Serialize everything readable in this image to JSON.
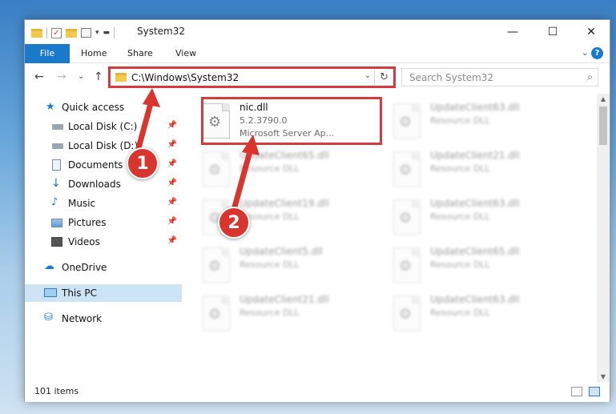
{
  "window": {
    "title": "System32",
    "controls": {
      "minimize": "—",
      "maximize": "☐",
      "close": "✕"
    }
  },
  "ribbon": {
    "tabs": [
      {
        "label": "File"
      },
      {
        "label": "Home"
      },
      {
        "label": "Share"
      },
      {
        "label": "View"
      }
    ],
    "help": "?"
  },
  "nav": {
    "address": "C:\\Windows\\System32",
    "search_placeholder": "Search System32"
  },
  "sidebar": {
    "items": [
      {
        "label": "Quick access",
        "icon": "star-icon"
      },
      {
        "label": "Local Disk (C:)",
        "icon": "drive-icon",
        "pinned": true
      },
      {
        "label": "Local Disk (D:)",
        "icon": "drive-icon",
        "pinned": true
      },
      {
        "label": "Documents",
        "icon": "documents-icon",
        "pinned": true
      },
      {
        "label": "Downloads",
        "icon": "download-icon",
        "pinned": true
      },
      {
        "label": "Music",
        "icon": "music-icon",
        "pinned": true
      },
      {
        "label": "Pictures",
        "icon": "pictures-icon",
        "pinned": true
      },
      {
        "label": "Videos",
        "icon": "videos-icon",
        "pinned": true
      },
      {
        "label": "OneDrive",
        "icon": "cloud-icon"
      },
      {
        "label": "This PC",
        "icon": "monitor-icon",
        "selected": true
      },
      {
        "label": "Network",
        "icon": "network-icon"
      }
    ]
  },
  "files": {
    "highlighted": {
      "name": "nic.dll",
      "version": "5.2.3790.0",
      "description": "Microsoft Server Ap..."
    },
    "left_column": [
      {
        "name": "UpdateClient65.dll",
        "type": "Resource DLL"
      },
      {
        "name": "UpdateClient19.dll",
        "type": "Resource DLL"
      },
      {
        "name": "UpdateClient5.dll",
        "type": "Resource DLL"
      },
      {
        "name": "UpdateClient21.dll",
        "type": "Resource DLL"
      }
    ],
    "right_column": [
      {
        "name": "UpdateClient63.dll",
        "type": "Resource DLL"
      },
      {
        "name": "UpdateClient21.dll",
        "type": "Resource DLL"
      },
      {
        "name": "UpdateClient63.dll",
        "type": "Resource DLL"
      },
      {
        "name": "UpdateClient65.dll",
        "type": "Resource DLL"
      },
      {
        "name": "UpdateClient63.dll",
        "type": "Resource DLL"
      }
    ]
  },
  "status": {
    "item_count": "101 items"
  },
  "annotations": {
    "markers": [
      "1",
      "2"
    ],
    "highlight_color": "#d23c3c"
  }
}
